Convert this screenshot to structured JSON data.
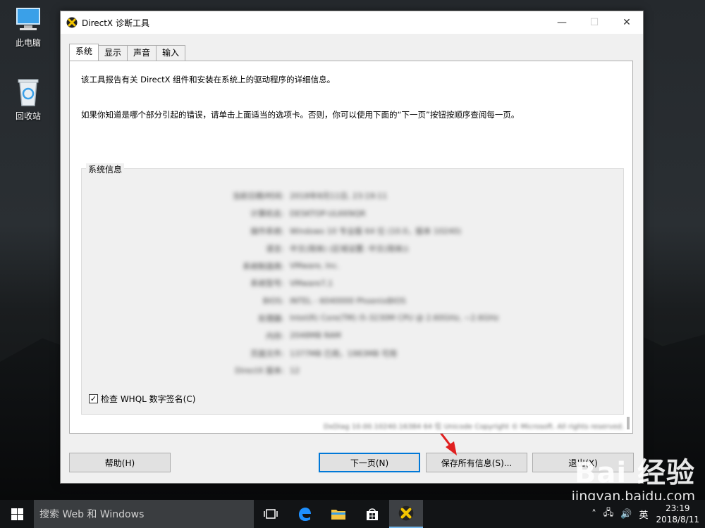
{
  "desktop": {
    "icons": [
      {
        "label": "此电脑",
        "icon": "computer-icon"
      },
      {
        "label": "回收站",
        "icon": "recycle-bin-icon"
      }
    ]
  },
  "window": {
    "title": "DirectX 诊断工具",
    "controls": {
      "minimize": "—",
      "maximize": "☐",
      "close": "✕"
    },
    "tabs": [
      {
        "label": "系统",
        "active": true
      },
      {
        "label": "显示",
        "active": false
      },
      {
        "label": "声音",
        "active": false
      },
      {
        "label": "输入",
        "active": false
      }
    ],
    "intro_line1": "该工具报告有关 DirectX 组件和安装在系统上的驱动程序的详细信息。",
    "intro_line2": "如果你知道是哪个部分引起的错误，请单击上面适当的选项卡。否则，你可以使用下面的“下一页”按钮按顺序查阅每一页。",
    "system_info": {
      "group_label": "系统信息",
      "rows": [
        {
          "key": "当前日期/时间:",
          "value": "2018年8月11日, 23:19:11"
        },
        {
          "key": "计算机名:",
          "value": "DESKTOP-ULKKNQR"
        },
        {
          "key": "操作系统:",
          "value": "Windows 10 专业版 64 位 (10.0，版本 10240)"
        },
        {
          "key": "语言:",
          "value": "中文(简体) (区域设置: 中文(简体))"
        },
        {
          "key": "系统制造商:",
          "value": "VMware, Inc."
        },
        {
          "key": "系统型号:",
          "value": "VMware7,1"
        },
        {
          "key": "BIOS:",
          "value": "INTEL - 6040000 PhoenixBIOS"
        },
        {
          "key": "处理器:",
          "value": "Intel(R) Core(TM) i5-3230M CPU @ 2.60GHz, ~2.6GHz"
        },
        {
          "key": "内存:",
          "value": "2048MB RAM"
        },
        {
          "key": "页面文件:",
          "value": "1377MB 已用，1983MB 可用"
        },
        {
          "key": "DirectX 版本:",
          "value": "12"
        }
      ],
      "whql_checked": true,
      "whql_label": "检查 WHQL 数字签名(C)"
    },
    "copyright": "DxDiag 10.00.10240.16384 64 位 Unicode  Copyright © Microsoft. All rights reserved.",
    "buttons": {
      "help": "帮助(H)",
      "next": "下一页(N)",
      "save": "保存所有信息(S)...",
      "exit": "退出(X)"
    }
  },
  "taskbar": {
    "search_placeholder": "搜索 Web 和 Windows",
    "ime": "英",
    "time": "23:19",
    "date": "2018/8/11"
  },
  "watermark": {
    "logo": "Bai 经验",
    "url": "jingyan.baidu.com"
  },
  "colors": {
    "accent": "#0078d7",
    "annotation_arrow": "#e02020"
  }
}
